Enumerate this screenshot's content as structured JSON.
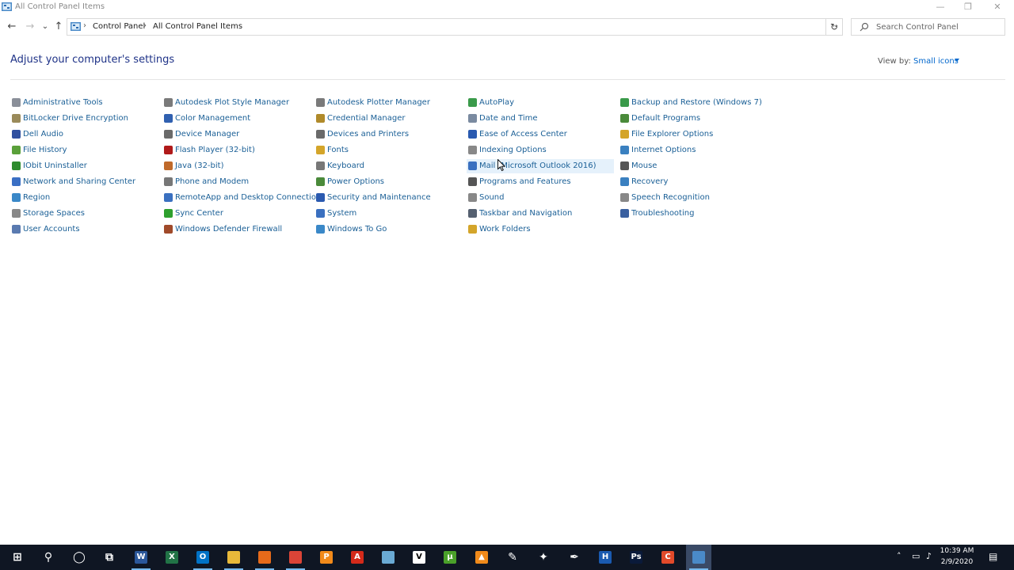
{
  "window": {
    "title": "All Control Panel Items",
    "minimize": "—",
    "maximize": "❐",
    "close": "✕"
  },
  "nav": {
    "back": "←",
    "forward": "→",
    "recent": "⌄",
    "up": "↑"
  },
  "address": {
    "crumbs": [
      "Control Panel",
      "All Control Panel Items"
    ],
    "separator": "›",
    "dropdown": "⌄",
    "refresh": "↻"
  },
  "search": {
    "placeholder": "Search Control Panel"
  },
  "heading": "Adjust your computer's settings",
  "view_by": {
    "label": "View by:",
    "value": "Small icons"
  },
  "columns": [
    [
      {
        "label": "Administrative Tools",
        "icon": "admin-tools-icon",
        "color": "#8a8f99"
      },
      {
        "label": "BitLocker Drive Encryption",
        "icon": "bitlocker-icon",
        "color": "#9a8a5a"
      },
      {
        "label": "Dell Audio",
        "icon": "dell-audio-icon",
        "color": "#3050a0"
      },
      {
        "label": "File History",
        "icon": "file-history-icon",
        "color": "#5aa03a"
      },
      {
        "label": "IObit Uninstaller",
        "icon": "iobit-uninstaller-icon",
        "color": "#2e8b2e"
      },
      {
        "label": "Network and Sharing Center",
        "icon": "network-icon",
        "color": "#3a6fc4"
      },
      {
        "label": "Region",
        "icon": "region-icon",
        "color": "#3a88c8"
      },
      {
        "label": "Storage Spaces",
        "icon": "storage-spaces-icon",
        "color": "#888888"
      },
      {
        "label": "User Accounts",
        "icon": "user-accounts-icon",
        "color": "#5a7ab0"
      }
    ],
    [
      {
        "label": "Autodesk Plot Style Manager",
        "icon": "plot-style-icon",
        "color": "#7a7a7a"
      },
      {
        "label": "Color Management",
        "icon": "color-management-icon",
        "color": "#3060b0"
      },
      {
        "label": "Device Manager",
        "icon": "device-manager-icon",
        "color": "#6a6a6a"
      },
      {
        "label": "Flash Player (32-bit)",
        "icon": "flash-player-icon",
        "color": "#b01a1a"
      },
      {
        "label": "Java (32-bit)",
        "icon": "java-icon",
        "color": "#c06a2a"
      },
      {
        "label": "Phone and Modem",
        "icon": "phone-modem-icon",
        "color": "#777777"
      },
      {
        "label": "RemoteApp and Desktop Connections",
        "icon": "remoteapp-icon",
        "color": "#3a70c0"
      },
      {
        "label": "Sync Center",
        "icon": "sync-center-icon",
        "color": "#2ea02e"
      },
      {
        "label": "Windows Defender Firewall",
        "icon": "firewall-icon",
        "color": "#a04a2a"
      }
    ],
    [
      {
        "label": "Autodesk Plotter Manager",
        "icon": "plotter-manager-icon",
        "color": "#7a7a7a"
      },
      {
        "label": "Credential Manager",
        "icon": "credential-manager-icon",
        "color": "#b08a2a"
      },
      {
        "label": "Devices and Printers",
        "icon": "devices-printers-icon",
        "color": "#6a6a6a"
      },
      {
        "label": "Fonts",
        "icon": "fonts-icon",
        "color": "#d4a52a"
      },
      {
        "label": "Keyboard",
        "icon": "keyboard-icon",
        "color": "#777777"
      },
      {
        "label": "Power Options",
        "icon": "power-options-icon",
        "color": "#4a8a3a"
      },
      {
        "label": "Security and Maintenance",
        "icon": "security-flag-icon",
        "color": "#2a5ab0"
      },
      {
        "label": "System",
        "icon": "system-icon",
        "color": "#3a70c0"
      },
      {
        "label": "Windows To Go",
        "icon": "windows-to-go-icon",
        "color": "#3a88c8"
      }
    ],
    [
      {
        "label": "AutoPlay",
        "icon": "autoplay-icon",
        "color": "#3a9a4a"
      },
      {
        "label": "Date and Time",
        "icon": "date-time-icon",
        "color": "#7a8aa0"
      },
      {
        "label": "Ease of Access Center",
        "icon": "ease-of-access-icon",
        "color": "#2a5ab0"
      },
      {
        "label": "Indexing Options",
        "icon": "indexing-options-icon",
        "color": "#888888"
      },
      {
        "label": "Mail (Microsoft Outlook 2016)",
        "icon": "mail-icon",
        "color": "#3a70c0"
      },
      {
        "label": "Programs and Features",
        "icon": "programs-features-icon",
        "color": "#555555"
      },
      {
        "label": "Sound",
        "icon": "sound-icon",
        "color": "#888888"
      },
      {
        "label": "Taskbar and Navigation",
        "icon": "taskbar-navigation-icon",
        "color": "#556070"
      },
      {
        "label": "Work Folders",
        "icon": "work-folders-icon",
        "color": "#d4a52a"
      }
    ],
    [
      {
        "label": "Backup and Restore (Windows 7)",
        "icon": "backup-restore-icon",
        "color": "#3a9a4a"
      },
      {
        "label": "Default Programs",
        "icon": "default-programs-icon",
        "color": "#4a8a3a"
      },
      {
        "label": "File Explorer Options",
        "icon": "file-explorer-options-icon",
        "color": "#d4a52a"
      },
      {
        "label": "Internet Options",
        "icon": "internet-options-icon",
        "color": "#3a80c0"
      },
      {
        "label": "Mouse",
        "icon": "mouse-icon",
        "color": "#555555"
      },
      {
        "label": "Recovery",
        "icon": "recovery-icon",
        "color": "#3a80c0"
      },
      {
        "label": "Speech Recognition",
        "icon": "speech-recognition-icon",
        "color": "#888888"
      },
      {
        "label": "Troubleshooting",
        "icon": "troubleshooting-icon",
        "color": "#3a60a0"
      }
    ]
  ],
  "highlighted_item": "Mail (Microsoft Outlook 2016)",
  "taskbar": {
    "apps": [
      {
        "name": "start-icon",
        "glyph": "⊞",
        "bg": "transparent"
      },
      {
        "name": "search-taskbar-icon",
        "glyph": "⚲",
        "bg": "transparent"
      },
      {
        "name": "cortana-icon",
        "glyph": "◯",
        "bg": "transparent"
      },
      {
        "name": "task-view-icon",
        "glyph": "⧉",
        "bg": "transparent"
      },
      {
        "name": "word-icon",
        "glyph": "W",
        "bg": "#2b579a"
      },
      {
        "name": "excel-icon",
        "glyph": "X",
        "bg": "#217346"
      },
      {
        "name": "outlook-icon",
        "glyph": "O",
        "bg": "#0072c6"
      },
      {
        "name": "file-explorer-icon",
        "glyph": "",
        "bg": "#e8b93a"
      },
      {
        "name": "firefox-icon",
        "glyph": "",
        "bg": "#e66a1a"
      },
      {
        "name": "chrome-icon",
        "glyph": "",
        "bg": "#db4437"
      },
      {
        "name": "pdf-tool-icon",
        "glyph": "P",
        "bg": "#f28a1a"
      },
      {
        "name": "acrobat-icon",
        "glyph": "A",
        "bg": "#d42a1a"
      },
      {
        "name": "settings-app-icon",
        "glyph": "",
        "bg": "#6aaad4"
      },
      {
        "name": "vnc-icon",
        "glyph": "V",
        "bg": "#ffffff"
      },
      {
        "name": "utorrent-icon",
        "glyph": "µ",
        "bg": "#4aa02a"
      },
      {
        "name": "vlc-icon",
        "glyph": "▲",
        "bg": "#f08a1a"
      },
      {
        "name": "tool-icon",
        "glyph": "✎",
        "bg": "transparent"
      },
      {
        "name": "colors-icon",
        "glyph": "✦",
        "bg": "transparent"
      },
      {
        "name": "pen-icon",
        "glyph": "✒",
        "bg": "transparent"
      },
      {
        "name": "hp-icon",
        "glyph": "H",
        "bg": "#1a5ab0"
      },
      {
        "name": "photoshop-icon",
        "glyph": "Ps",
        "bg": "#0a1a3a"
      },
      {
        "name": "c-app-icon",
        "glyph": "C",
        "bg": "#e24a2a"
      },
      {
        "name": "control-panel-taskbar-icon",
        "glyph": "",
        "bg": "#4a8ac8"
      }
    ],
    "time": "10:39 AM",
    "date": "2/9/2020"
  }
}
